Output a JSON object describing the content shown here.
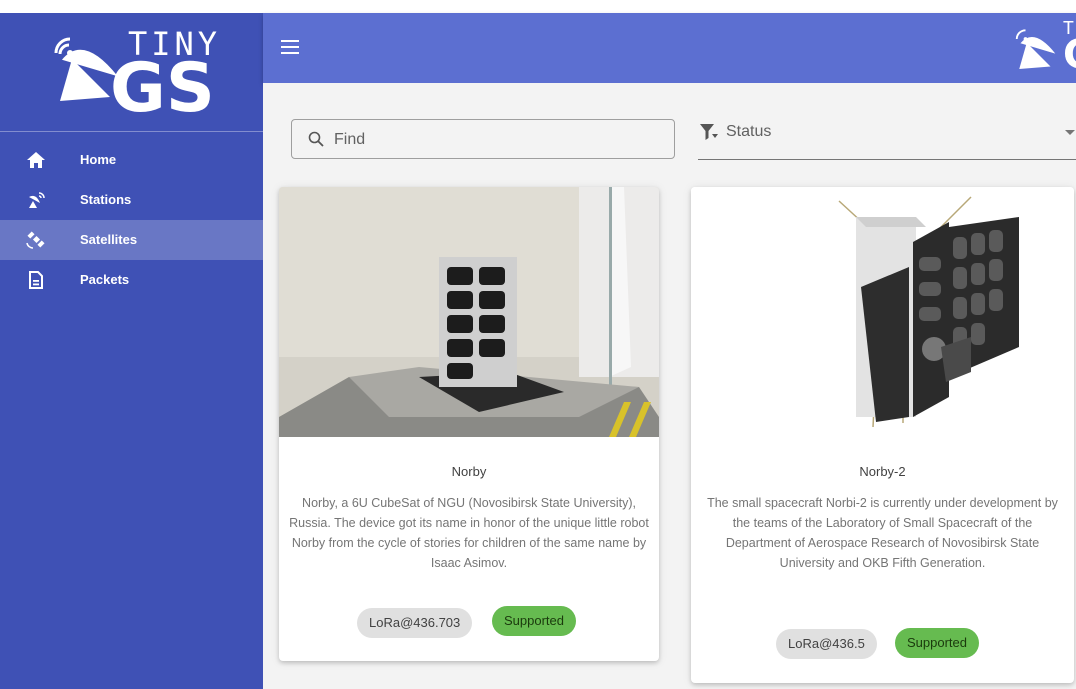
{
  "brand": {
    "tiny": "TINY",
    "gs": "GS",
    "top_tiny": "T",
    "top_gs": "G"
  },
  "sidebar": {
    "items": [
      {
        "label": "Home",
        "icon": "home-icon",
        "active": false
      },
      {
        "label": "Stations",
        "icon": "antenna-icon",
        "active": false
      },
      {
        "label": "Satellites",
        "icon": "satellite-icon",
        "active": true
      },
      {
        "label": "Packets",
        "icon": "document-icon",
        "active": false
      }
    ]
  },
  "toolbar": {
    "menu_icon": "menu-icon"
  },
  "filters": {
    "search_placeholder": "Find",
    "status_label": "Status"
  },
  "cards": [
    {
      "title": "Norby",
      "description": "Norby, a 6U CubeSat of NGU (Novosibirsk State University), Russia. The device got its name in honor of the unique little robot Norby from the cycle of stories for children of the same name by Isaac Asimov.",
      "frequency": "LoRa@436.703",
      "status": "Supported"
    },
    {
      "title": "Norby-2",
      "description": "The small spacecraft Norbi-2 is currently under development by the teams of the Laboratory of Small Spacecraft of the Department of Aerospace Research of Novosibirsk State University and OKB Fifth Generation.",
      "frequency": "LoRa@436.5",
      "status": "Supported"
    }
  ],
  "colors": {
    "sidebar": "#3f51b5",
    "topbar": "#5c6fd1",
    "supported": "#66bb50",
    "chip": "#e0e0e0"
  }
}
